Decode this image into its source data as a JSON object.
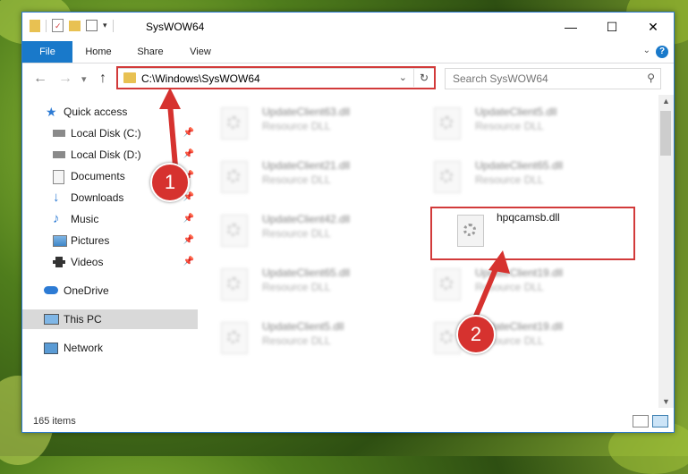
{
  "window": {
    "title": "SysWOW64",
    "minimize": "—",
    "maximize": "☐",
    "close": "✕"
  },
  "ribbon": {
    "tabs": [
      {
        "label": "File"
      },
      {
        "label": "Home"
      },
      {
        "label": "Share"
      },
      {
        "label": "View"
      }
    ],
    "help": "?"
  },
  "navigation": {
    "back": "←",
    "forward": "→",
    "recent": "▾",
    "up": "↑",
    "address_path": "C:\\Windows\\SysWOW64",
    "address_dropdown": "⌄",
    "refresh": "↻"
  },
  "search": {
    "placeholder": "Search SysWOW64",
    "icon": "⚲"
  },
  "sidebar": {
    "items": [
      {
        "label": "Quick access",
        "icon": "star-icon"
      },
      {
        "label": "Local Disk (C:)",
        "icon": "drive-icon",
        "pinned": true
      },
      {
        "label": "Local Disk (D:)",
        "icon": "drive-icon",
        "pinned": true
      },
      {
        "label": "Documents",
        "icon": "documents-icon",
        "pinned": true
      },
      {
        "label": "Downloads",
        "icon": "download-icon",
        "pinned": true
      },
      {
        "label": "Music",
        "icon": "music-icon",
        "pinned": true
      },
      {
        "label": "Pictures",
        "icon": "pictures-icon",
        "pinned": true
      },
      {
        "label": "Videos",
        "icon": "videos-icon",
        "pinned": true
      },
      {
        "label": "OneDrive",
        "icon": "cloud-icon"
      },
      {
        "label": "This PC",
        "icon": "computer-icon",
        "selected": true
      },
      {
        "label": "Network",
        "icon": "network-icon"
      }
    ]
  },
  "files": [
    {
      "name": "UpdateClient63.dll",
      "type": "Resource DLL",
      "blurred": true
    },
    {
      "name": "UpdateClient5.dll",
      "type": "Resource DLL",
      "blurred": true
    },
    {
      "name": "UpdateClient21.dll",
      "type": "Resource DLL",
      "blurred": true
    },
    {
      "name": "UpdateClient65.dll",
      "type": "Resource DLL",
      "blurred": true
    },
    {
      "name": "UpdateClient42.dll",
      "type": "Resource DLL",
      "blurred": true
    },
    {
      "name": "hpqcamsb.dll",
      "type": "",
      "blurred": false
    },
    {
      "name": "UpdateClient65.dll",
      "type": "Resource DLL",
      "blurred": true
    },
    {
      "name": "UpdateClient19.dll",
      "type": "Resource DLL",
      "blurred": true
    },
    {
      "name": "UpdateClient5.dll",
      "type": "Resource DLL",
      "blurred": true
    },
    {
      "name": "UpdateClient19.dll",
      "type": "Resource DLL",
      "blurred": true
    }
  ],
  "status": {
    "item_count": "165 items"
  },
  "annotations": {
    "step1": "1",
    "step2": "2",
    "color": "#d23a3a"
  },
  "colors": {
    "accent": "#1979ca",
    "selected_bg": "#d9d9d9"
  }
}
